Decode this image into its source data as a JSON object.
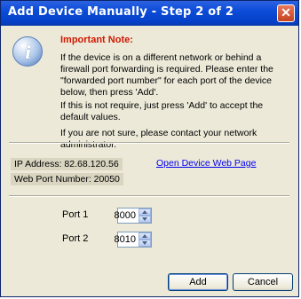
{
  "window": {
    "title": "Add Device Manually - Step 2 of 2",
    "close_glyph": "✕"
  },
  "note": {
    "icon": "info-icon",
    "icon_glyph": "i",
    "title": "Important Note:",
    "paragraphs": [
      "If the device is on a different network or behind a firewall port forwarding is required. Please enter the \"forwarded port number\" for each port of the device below, then press 'Add'.",
      "If this is not require, just press 'Add' to accept the default values.",
      "If you are not sure, please contact your network administrator."
    ],
    "title_color": "#d01800"
  },
  "device": {
    "ip_address": "IP Address: 82.68.120.56",
    "web_port": "Web Port Number: 20050",
    "link_text": "Open Device Web Page"
  },
  "ports": [
    {
      "label": "Port 1",
      "value": "8000"
    },
    {
      "label": "Port 2",
      "value": "8010"
    }
  ],
  "buttons": {
    "add": "Add",
    "cancel": "Cancel"
  }
}
